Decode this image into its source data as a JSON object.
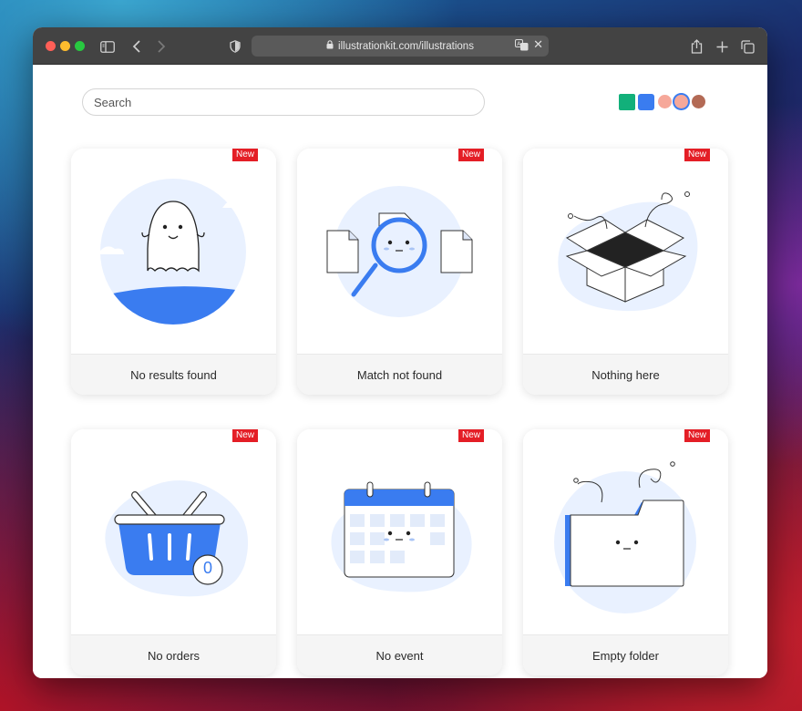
{
  "browser": {
    "url": "illustrationkit.com/illustrations",
    "traffic_lights": [
      "#ff5f57",
      "#febc2e",
      "#28c840"
    ]
  },
  "page": {
    "search_placeholder": "Search",
    "color_swatches": [
      "#12b07a",
      "#3a7cf0",
      "#f6a89a",
      "#3a7cf0",
      "#b36a55"
    ]
  },
  "cards": [
    {
      "title": "No results found",
      "badge": "New",
      "icon": "ghost-illustration"
    },
    {
      "title": "Match not found",
      "badge": "New",
      "icon": "magnifier-illustration"
    },
    {
      "title": "Nothing here",
      "badge": "New",
      "icon": "open-box-illustration"
    },
    {
      "title": "No orders",
      "badge": "New",
      "icon": "basket-illustration",
      "count": "0"
    },
    {
      "title": "No event",
      "badge": "New",
      "icon": "calendar-illustration"
    },
    {
      "title": "Empty folder",
      "badge": "New",
      "icon": "folder-illustration"
    }
  ]
}
